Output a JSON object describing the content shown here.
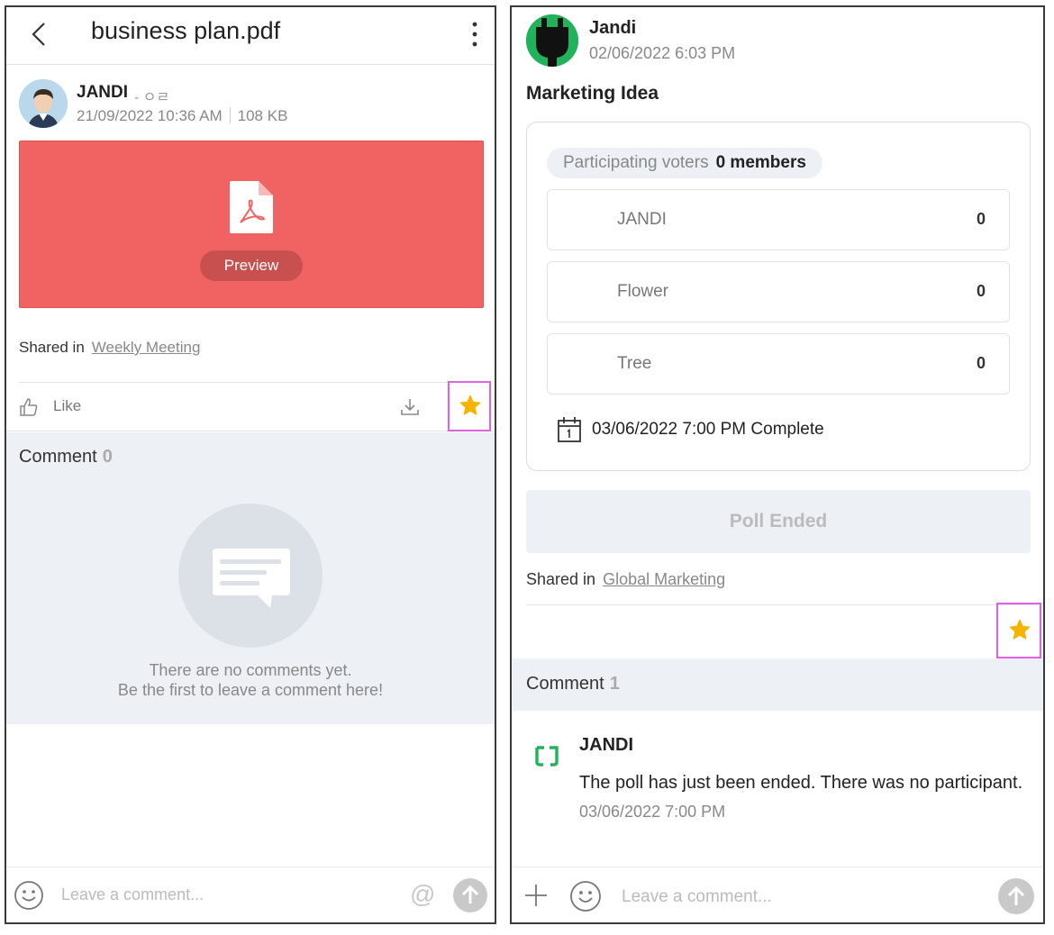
{
  "left": {
    "header": {
      "title": "business plan.pdf"
    },
    "author": {
      "name": "JANDI",
      "tag": "- ㅇㄹ",
      "datetime": "21/09/2022 10:36 AM",
      "size": "108 KB"
    },
    "file": {
      "preview_label": "Preview"
    },
    "shared": {
      "label": "Shared in",
      "link": "Weekly Meeting"
    },
    "actions": {
      "like_label": "Like"
    },
    "comments": {
      "title": "Comment",
      "count": "0",
      "empty_line1": "There are no comments yet.",
      "empty_line2": "Be the first to leave a comment here!"
    },
    "input": {
      "placeholder": "Leave a comment..."
    }
  },
  "right": {
    "author": {
      "name": "Jandi",
      "datetime": "02/06/2022 6:03 PM"
    },
    "poll": {
      "title": "Marketing Idea",
      "voters_label": "Participating voters",
      "voters_count": "0 members",
      "options": [
        {
          "label": "JANDI",
          "count": "0"
        },
        {
          "label": "Flower",
          "count": "0"
        },
        {
          "label": "Tree",
          "count": "0"
        }
      ],
      "deadline": "03/06/2022 7:00 PM Complete",
      "status_button": "Poll Ended"
    },
    "shared": {
      "label": "Shared in",
      "link": "Global Marketing"
    },
    "comments": {
      "title": "Comment",
      "count": "1",
      "items": [
        {
          "author": "JANDI",
          "text": "The poll has just been ended. There was no participant.",
          "datetime": "03/06/2022 7:00 PM"
        }
      ]
    },
    "input": {
      "placeholder": "Leave a comment..."
    }
  },
  "colors": {
    "file_red": "#f06362",
    "star_yellow": "#f6b400",
    "highlight_pink": "#e061e6",
    "jandi_green": "#21b35b"
  }
}
